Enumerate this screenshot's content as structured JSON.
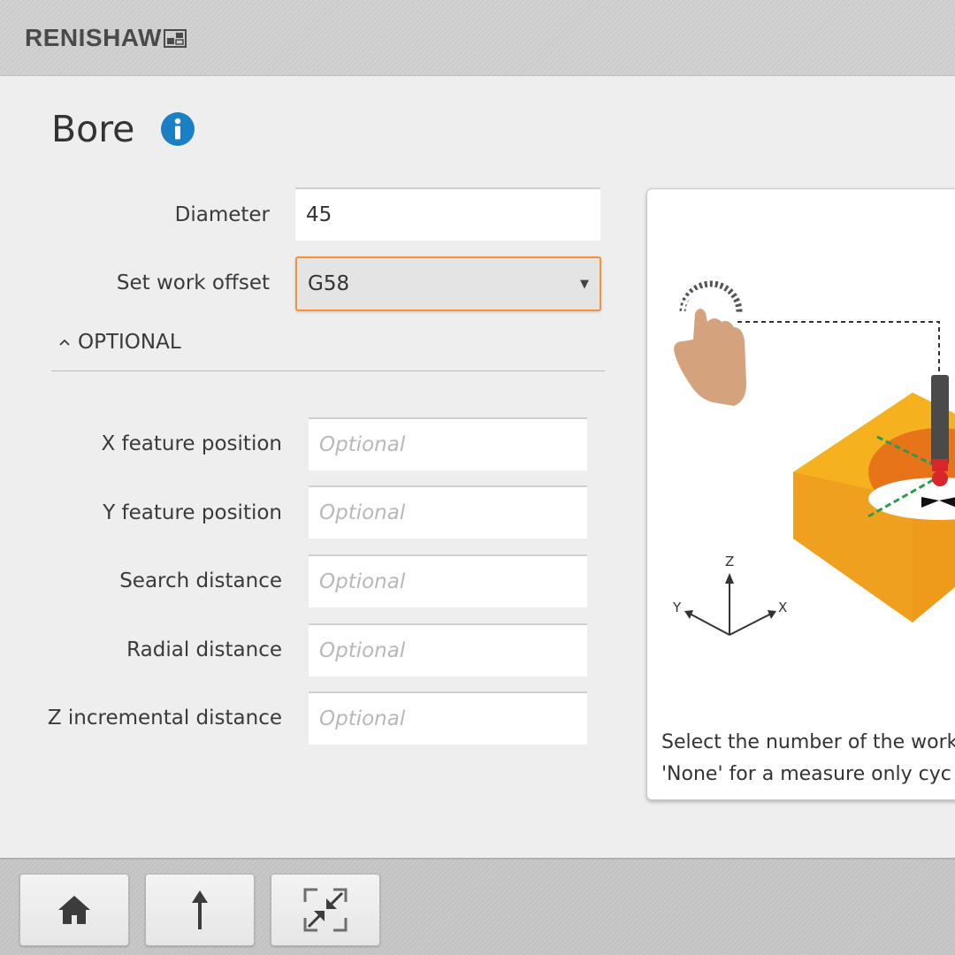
{
  "header": {
    "logo_text": "RENISHAW",
    "logo_icon": "renishaw-mark-icon"
  },
  "page": {
    "title": "Bore",
    "info_icon": "info-icon"
  },
  "form": {
    "diameter": {
      "label": "Diameter",
      "value": "45"
    },
    "work_offset": {
      "label": "Set work offset",
      "value": "G58",
      "icon": "dropdown-arrow-icon"
    }
  },
  "optional": {
    "header_label": "OPTIONAL",
    "toggle_icon": "chevron-up-icon",
    "fields": [
      {
        "label": "X feature position",
        "placeholder": "Optional"
      },
      {
        "label": "Y feature position",
        "placeholder": "Optional"
      },
      {
        "label": "Search distance",
        "placeholder": "Optional"
      },
      {
        "label": "Radial distance",
        "placeholder": "Optional"
      },
      {
        "label": "Z incremental distance",
        "placeholder": "Optional"
      }
    ]
  },
  "panel": {
    "axes": {
      "z": "Z",
      "y": "Y",
      "x": "X"
    },
    "help_line1": "Select the number of the work",
    "help_line2": "'None' for a measure only cyc",
    "colors": {
      "block_top": "#f5b21e",
      "block_side": "#ee9a1b",
      "bore": "#e8741a",
      "probe": "#4a4a4a",
      "probe_tip": "#d9262b",
      "path": "#2e9a4e"
    }
  },
  "toolbar": {
    "buttons": [
      {
        "name": "home-button",
        "icon": "home-icon"
      },
      {
        "name": "up-button",
        "icon": "arrow-up-icon"
      },
      {
        "name": "minimize-button",
        "icon": "collapse-icon"
      }
    ]
  },
  "colors": {
    "accent_focus": "#f0923a",
    "info_blue": "#1b7fc4"
  }
}
